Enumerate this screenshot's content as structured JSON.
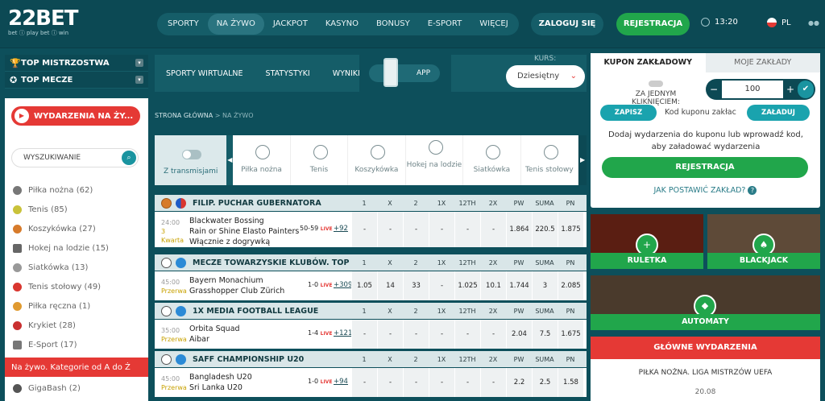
{
  "header": {
    "logo_main": "22BET",
    "logo_sub": "bet ⓘ play bet ⓘ win",
    "nav": [
      "SPORTY",
      "NA ŻYWO",
      "JACKPOT",
      "KASYNO",
      "BONUSY",
      "E-SPORT",
      "WIĘCEJ"
    ],
    "login": "ZALOGUJ SIĘ",
    "register": "REJESTRACJA",
    "time": "13:20",
    "lang": "PL"
  },
  "left": {
    "top_championships": "TOP MISTRZOSTWA",
    "top_matches": "TOP MECZE",
    "live_btn": "WYDARZENIA NA ŻY...",
    "search_placeholder": "WYSZUKIWANIE",
    "sports": [
      {
        "label": "Piłka nożna (62)",
        "color": "#777"
      },
      {
        "label": "Tenis (85)",
        "color": "#c9c23a"
      },
      {
        "label": "Koszykówka (27)",
        "color": "#d77b2b"
      },
      {
        "label": "Hokej na lodzie (15)",
        "color": "#666"
      },
      {
        "label": "Siatkówka (13)",
        "color": "#999"
      },
      {
        "label": "Tenis stołowy (49)",
        "color": "#d9362f"
      },
      {
        "label": "Piłka ręczna (1)",
        "color": "#e09a30"
      },
      {
        "label": "Krykiet (28)",
        "color": "#c93030"
      },
      {
        "label": "E-Sport (17)",
        "color": "#777"
      }
    ],
    "category_all": "Na żywo. Kategorie od A do Ż",
    "gigabash": "GigaBash (2)"
  },
  "mid": {
    "subnav": [
      "SPORTY WIRTUALNE",
      "STATYSTYKI",
      "WYNIKI"
    ],
    "app": "APP",
    "kurs_label": "KURS:",
    "kurs_value": "Dziesiętny",
    "crumb_home": "STRONA GŁÓWNA",
    "crumb_sep": " > ",
    "crumb_cur": "NA ŻYWO",
    "with_stream": "Z transmisjami",
    "sports_bar": [
      "Piłka nożna",
      "Tenis",
      "Koszykówka",
      "Hokej na lodzie",
      "Siatkówka",
      "Tenis stołowy"
    ],
    "columns": [
      "1",
      "X",
      "2",
      "1X",
      "12TH",
      "2X",
      "PW",
      "SUMA",
      "PN"
    ],
    "leagues": [
      {
        "name": "FILIP. PUCHAR GUBERNATORA",
        "event": {
          "time": "24:00",
          "period": "3 Kwarta",
          "teams": [
            "Blackwater Bossing",
            "Rain or Shine Elasto Painters",
            "Włącznie z dogrywką"
          ],
          "score": "50-59",
          "live": "LIVE",
          "more": "+92",
          "odds": [
            "-",
            "-",
            "-",
            "-",
            "-",
            "-",
            "1.864",
            "220.5",
            "1.875"
          ]
        }
      },
      {
        "name": "MECZE TOWARZYSKIE KLUBÓW. TOP",
        "event": {
          "time": "45:00",
          "period": "Przerwa",
          "teams": [
            "Bayern Monachium",
            "Grasshopper Club Zürich"
          ],
          "score": "1-0",
          "live": "LIVE",
          "more": "+309",
          "odds": [
            "1.05",
            "14",
            "33",
            "-",
            "1.025",
            "10.1",
            "1.744",
            "3",
            "2.085"
          ]
        }
      },
      {
        "name": "1X MEDIA FOOTBALL LEAGUE",
        "event": {
          "time": "35:00",
          "period": "Przerwa",
          "teams": [
            "Orbita Squad",
            "Aibar"
          ],
          "score": "1-4",
          "live": "LIVE",
          "more": "+121",
          "odds": [
            "-",
            "-",
            "-",
            "-",
            "-",
            "-",
            "2.04",
            "7.5",
            "1.675"
          ]
        }
      },
      {
        "name": "SAFF CHAMPIONSHIP U20",
        "event": {
          "time": "45:00",
          "period": "Przerwa",
          "teams": [
            "Bangladesh U20",
            "Sri Lanka U20"
          ],
          "score": "1-0",
          "live": "LIVE",
          "more": "+94",
          "odds": [
            "-",
            "-",
            "-",
            "-",
            "-",
            "-",
            "2.2",
            "2.5",
            "1.58"
          ]
        }
      }
    ]
  },
  "right": {
    "tab_slip": "KUPON ZAKŁADOWY",
    "tab_my": "MOJE ZAKŁADY",
    "one_click": "ZA JEDNYM KLIKNIĘCIEM:",
    "stake": "100",
    "save": "ZAPISZ",
    "code": "Kod kuponu zakłac",
    "load": "ZAŁADUJ",
    "hint": "Dodaj wydarzenia do kuponu lub wprowadź kod, aby załadować wydarzenia",
    "register": "REJESTRACJA",
    "how": "JAK POSTAWIĆ ZAKŁAD?",
    "roulette": "RULETKA",
    "blackjack": "BLACKJACK",
    "slots": "AUTOMATY",
    "main_events": "GŁÓWNE WYDARZENIA",
    "event_title": "PIŁKA NOŻNA. LIGA MISTRZÓW UEFA",
    "event_date": "20.08"
  }
}
